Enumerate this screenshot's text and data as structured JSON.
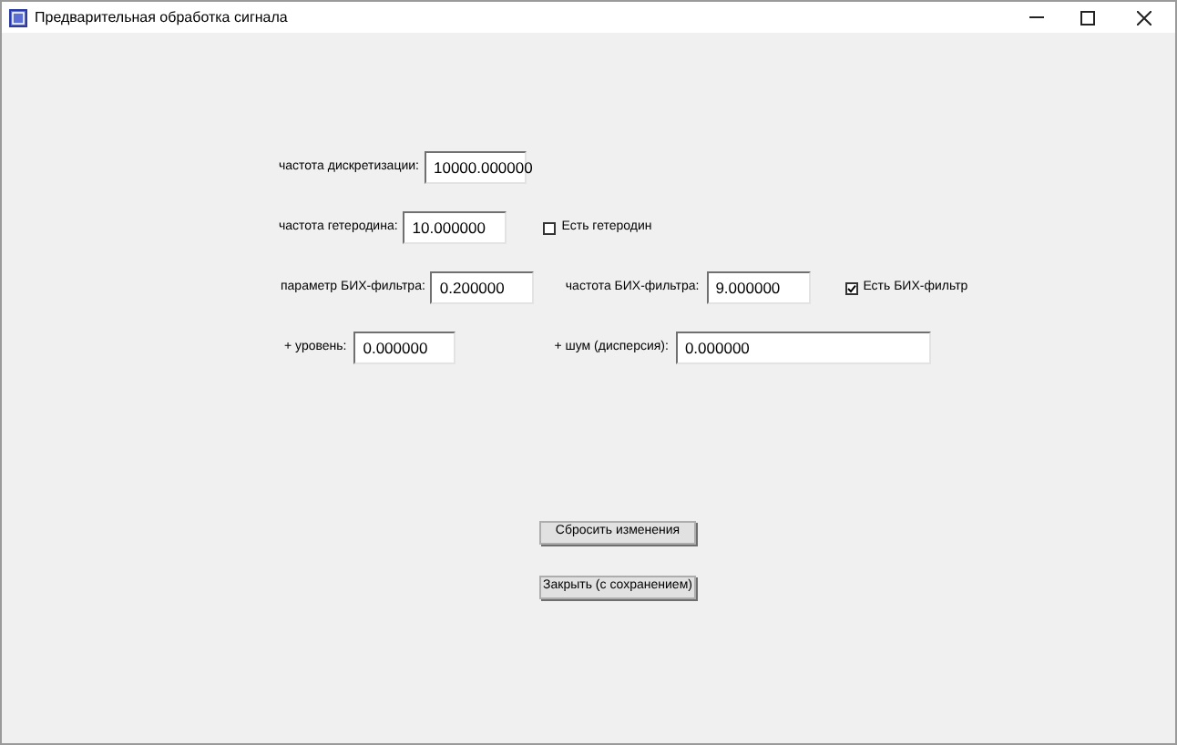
{
  "window": {
    "title": "Предварительная обработка сигнала"
  },
  "rows": [
    {
      "items": [
        {
          "kind": "field",
          "label": "частота дискретизации:",
          "value": "10000.000000"
        }
      ]
    },
    {
      "items": [
        {
          "kind": "field",
          "label": "частота гетеродина:",
          "value": "10.000000"
        },
        {
          "kind": "checkbox",
          "label": "Есть гетеродин",
          "checked": false
        }
      ]
    },
    {
      "items": [
        {
          "kind": "field",
          "label": "параметр БИХ-фильтра:",
          "value": "0.200000"
        },
        {
          "kind": "field",
          "label": "частота БИХ-фильтра:",
          "value": "9.000000"
        },
        {
          "kind": "checkbox",
          "label": "Есть БИХ-фильтр",
          "checked": true
        }
      ]
    },
    {
      "items": [
        {
          "kind": "field",
          "label": "+ уровень:",
          "value": "0.000000"
        },
        {
          "kind": "field",
          "label": "+ шум (дисперсия):",
          "value": "0.000000"
        }
      ]
    }
  ],
  "buttons": [
    {
      "label": "Сбросить изменения"
    },
    {
      "label": "Закрыть (с сохранением)"
    }
  ]
}
